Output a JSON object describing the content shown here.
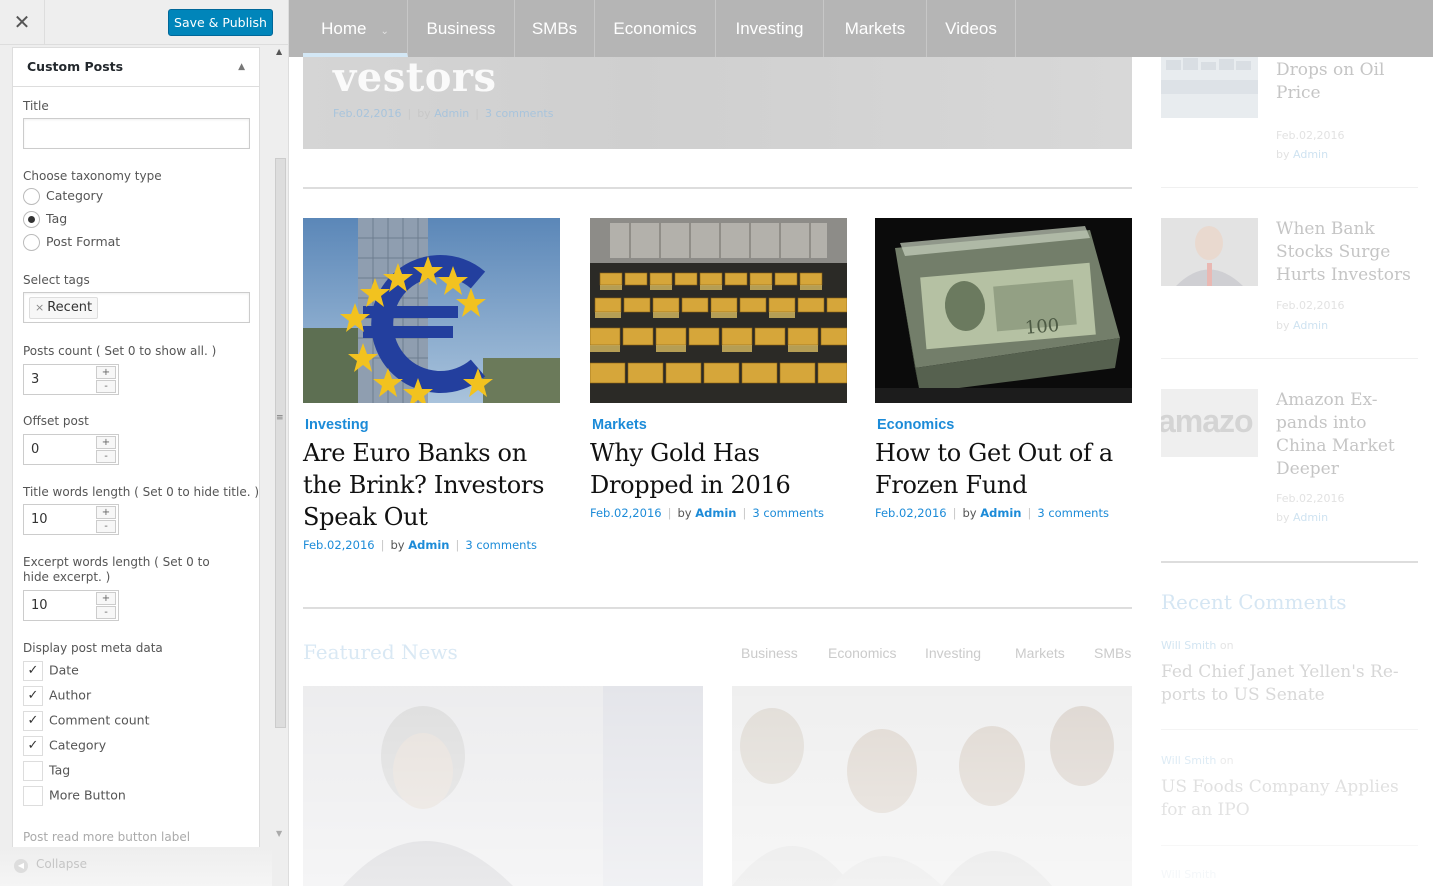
{
  "customizer": {
    "close_glyph": "✕",
    "save_label": "Save & Publish",
    "section_title": "Custom Posts",
    "title_label": "Title",
    "title_value": "",
    "taxonomy_label": "Choose taxonomy type",
    "taxonomy_options": [
      {
        "label": "Category",
        "selected": false
      },
      {
        "label": "Tag",
        "selected": true
      },
      {
        "label": "Post Format",
        "selected": false
      }
    ],
    "select_tags_label": "Select tags",
    "selected_tag": "Recent",
    "tag_remove_glyph": "×",
    "posts_count_label": "Posts count ( Set 0 to show all. )",
    "posts_count": "3",
    "offset_label": "Offset post",
    "offset": "0",
    "title_words_label": "Title words length ( Set 0 to hide title. )",
    "title_words": "10",
    "excerpt_words_label": "Excerpt words length ( Set 0 to hide excerpt. )",
    "excerpt_words": "10",
    "stepper_up": "+",
    "stepper_down": "-",
    "meta_label": "Display post meta data",
    "meta_options": [
      {
        "label": "Date",
        "checked": true
      },
      {
        "label": "Author",
        "checked": true
      },
      {
        "label": "Comment count",
        "checked": true
      },
      {
        "label": "Category",
        "checked": true
      },
      {
        "label": "Tag",
        "checked": false
      },
      {
        "label": "More Button",
        "checked": false
      }
    ],
    "read_more_label": "Post read more button label",
    "collapse_label": "Collapse",
    "check_glyph": "✓"
  },
  "nav": {
    "items": [
      "Home",
      "Business",
      "SMBs",
      "Economics",
      "Investing",
      "Markets",
      "Videos"
    ],
    "active": "Home"
  },
  "hero": {
    "title": "vestors",
    "date": "Feb.02,2016",
    "by": "by",
    "author": "Admin",
    "comments": "3 comments"
  },
  "cards": [
    {
      "category": "Investing",
      "title": "Are Euro Banks on the Brink? Investors Speak Out",
      "date": "Feb.02,2016",
      "by": "by",
      "author": "Admin",
      "comments": "3 comments"
    },
    {
      "category": "Markets",
      "title": "Why Gold Has Dropped in 2016",
      "date": "Feb.02,2016",
      "by": "by",
      "author": "Admin",
      "comments": "3 comments"
    },
    {
      "category": "Economics",
      "title": "How to Get Out of a Frozen Fund",
      "date": "Feb.02,2016",
      "by": "by",
      "author": "Admin",
      "comments": "3 comments"
    }
  ],
  "featured": {
    "title": "Featured News",
    "tabs": [
      "Business",
      "Economics",
      "Investing",
      "Markets",
      "SMBs"
    ]
  },
  "sidebar": {
    "posts": [
      {
        "title": "Maersk's Profit Drops on Oil Price",
        "date": "Feb.02,2016",
        "by": "by",
        "author": "Admin"
      },
      {
        "title": "When Bank Stocks Surge Hurts Investors",
        "date": "Feb.02,2016",
        "by": "by",
        "author": "Admin"
      },
      {
        "title": "Amazon Ex-pands into China Market Deeper",
        "date": "Feb.02,2016",
        "by": "by",
        "author": "Admin"
      }
    ],
    "recent_comments_title": "Recent Comments",
    "comments": [
      {
        "author": "Will Smith",
        "on": "on",
        "title": "Fed Chief Janet Yellen's Re-ports to US Senate"
      },
      {
        "author": "Will Smith",
        "on": "on",
        "title": "US Foods Company Applies for an IPO"
      },
      {
        "author": "Will Smith",
        "on": "",
        "title": ""
      }
    ],
    "amazon_text": "amazo"
  },
  "colors": {
    "accent": "#1c8bd8",
    "publish": "#0085ba",
    "nav_bg": "#b5b5b5"
  }
}
